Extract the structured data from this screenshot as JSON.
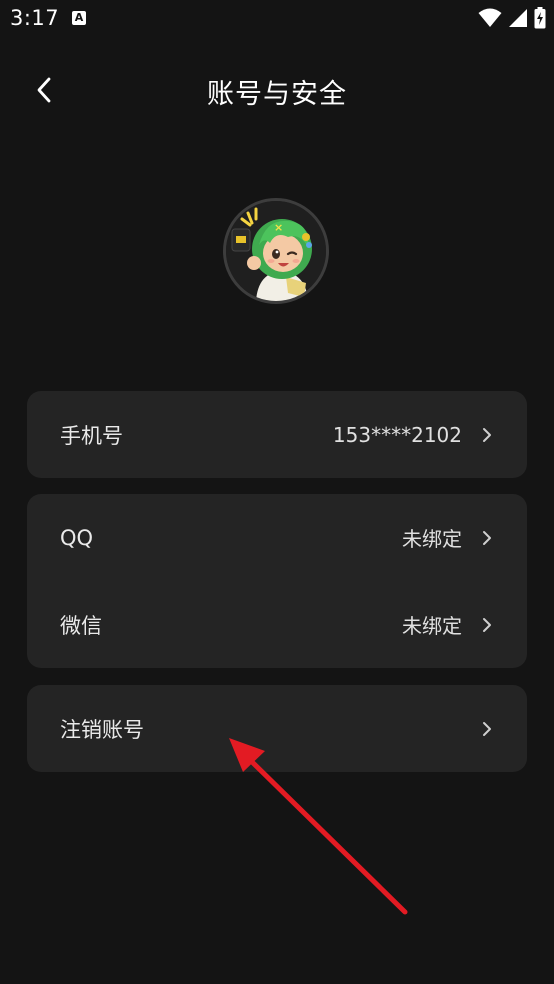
{
  "status_bar": {
    "time": "3:17",
    "notif_icon": "A",
    "icons": [
      "wifi-icon",
      "cell-signal-icon",
      "battery-charging-icon"
    ]
  },
  "header": {
    "title": "账号与安全",
    "back_icon": "chevron-left-icon"
  },
  "avatar": {
    "icon": "cartoon-avatar"
  },
  "cards": [
    {
      "rows": [
        {
          "label": "手机号",
          "value": "153****2102"
        }
      ]
    },
    {
      "rows": [
        {
          "label": "QQ",
          "value": "未绑定"
        },
        {
          "label": "微信",
          "value": "未绑定"
        }
      ]
    },
    {
      "rows": [
        {
          "label": "注销账号",
          "value": ""
        }
      ]
    }
  ],
  "annotation": {
    "color": "#e31b23",
    "icon": "red-arrow"
  },
  "colors": {
    "background": "#141414",
    "card": "#242424",
    "text": "#ffffff"
  }
}
